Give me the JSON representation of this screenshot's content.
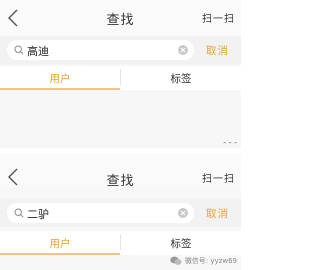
{
  "screens": [
    {
      "title": "查找",
      "scan_label": "扫一扫",
      "search_query": "高迪",
      "cancel_label": "取消",
      "tabs": [
        "用户",
        "标签"
      ],
      "active_tab": "用户",
      "more_indicator": "- - -"
    },
    {
      "title": "查找",
      "scan_label": "扫一扫",
      "search_query": "二驴",
      "cancel_label": "取消",
      "tabs": [
        "用户",
        "标签"
      ],
      "active_tab": "用户"
    }
  ],
  "watermark": "微信号: yyzw69",
  "colors": {
    "accent": "#e9a03a",
    "underline": "#f0c489",
    "background": "#f7f7f7"
  },
  "icons": [
    "back-chevron-icon",
    "search-icon",
    "clear-icon",
    "wechat-icon"
  ]
}
